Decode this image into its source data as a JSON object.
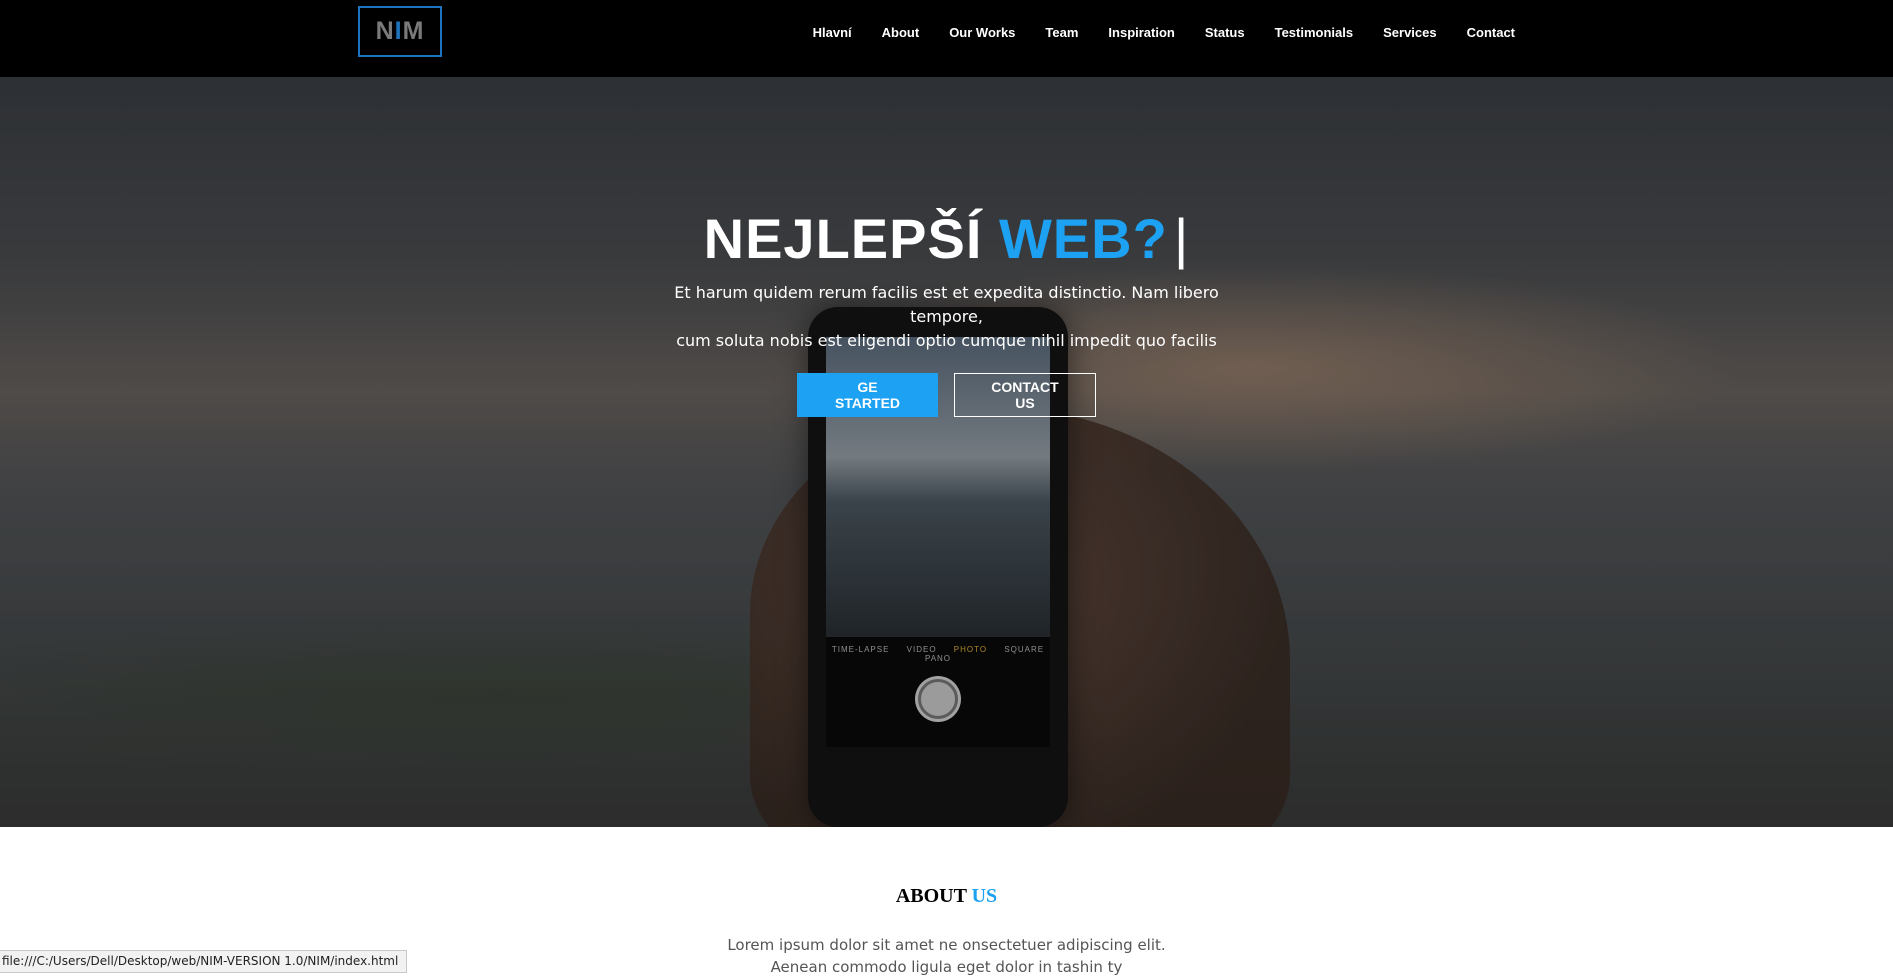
{
  "header": {
    "logo": {
      "text_start": "N",
      "text_accent": "I",
      "text_end": "M"
    },
    "nav": [
      {
        "label": "Hlavní"
      },
      {
        "label": "About"
      },
      {
        "label": "Our Works"
      },
      {
        "label": "Team"
      },
      {
        "label": "Inspiration"
      },
      {
        "label": "Status"
      },
      {
        "label": "Testimonials"
      },
      {
        "label": "Services"
      },
      {
        "label": "Contact"
      }
    ]
  },
  "hero": {
    "title_main": "NEJLEPŠÍ",
    "title_accent": "WEB?",
    "title_cursor": "|",
    "subtitle_line1": "Et harum quidem rerum facilis est et expedita distinctio. Nam libero tempore,",
    "subtitle_line2": "cum soluta nobis est eligendi optio cumque nihil impedit quo facilis",
    "primary_button": "GE STARTED",
    "secondary_button": "CONTACT US",
    "phone_modes": {
      "before": "TIME-LAPSE VIDEO",
      "active": "PHOTO",
      "after": "SQUARE PANO"
    }
  },
  "about": {
    "title_main": "ABOUT",
    "title_accent": "US",
    "text": "Lorem ipsum dolor sit amet ne onsectetuer adipiscing elit. Aenean commodo ligula eget dolor in tashin ty"
  },
  "status_bar": {
    "url": "file:///C:/Users/Dell/Desktop/web/NIM-VERSION 1.0/NIM/index.html"
  },
  "colors": {
    "accent": "#1da1f2",
    "logo_border": "#1e73be",
    "header_bg": "#000000"
  }
}
